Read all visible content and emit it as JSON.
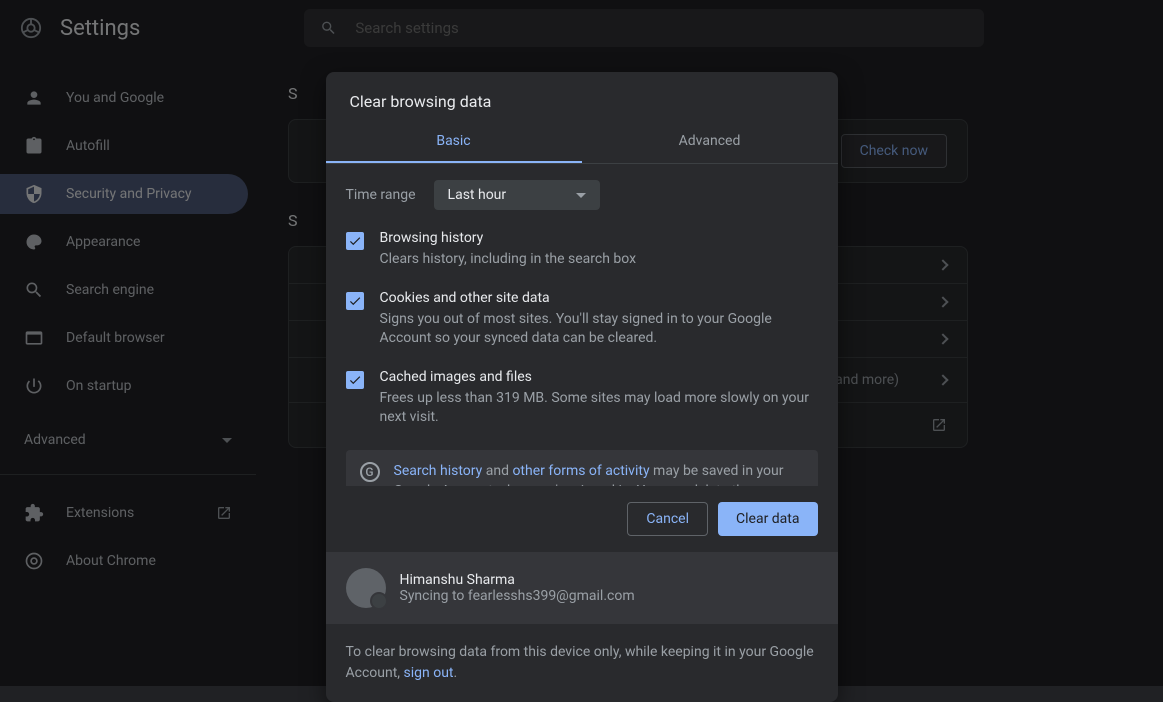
{
  "header": {
    "title": "Settings",
    "search_placeholder": "Search settings"
  },
  "sidebar": {
    "items": [
      {
        "label": "You and Google"
      },
      {
        "label": "Autofill"
      },
      {
        "label": "Security and Privacy"
      },
      {
        "label": "Appearance"
      },
      {
        "label": "Search engine"
      },
      {
        "label": "Default browser"
      },
      {
        "label": "On startup"
      }
    ],
    "advanced_label": "Advanced",
    "extensions_label": "Extensions",
    "about_label": "About Chrome"
  },
  "content": {
    "check_now": "Check now",
    "row_text": "and more)"
  },
  "dialog": {
    "title": "Clear browsing data",
    "tabs": {
      "basic": "Basic",
      "advanced": "Advanced"
    },
    "time_range_label": "Time range",
    "time_range_value": "Last hour",
    "checks": [
      {
        "title": "Browsing history",
        "desc": "Clears history, including in the search box"
      },
      {
        "title": "Cookies and other site data",
        "desc": "Signs you out of most sites. You'll stay signed in to your Google Account so your synced data can be cleared."
      },
      {
        "title": "Cached images and files",
        "desc": "Frees up less than 319 MB. Some sites may load more slowly on your next visit."
      }
    ],
    "info": {
      "link1": "Search history",
      "between": " and ",
      "link2": "other forms of activity",
      "rest": " may be saved in your Google Account when you're signed in. You can delete them anytime."
    },
    "cancel": "Cancel",
    "clear": "Clear data",
    "account": {
      "name": "Himanshu Sharma",
      "sync_prefix": "Syncing to ",
      "email": "fearlesshs399@gmail.com"
    },
    "footer": {
      "text": "To clear browsing data from this device only, while keeping it in your Google Account, ",
      "signout": "sign out",
      "period": "."
    }
  }
}
